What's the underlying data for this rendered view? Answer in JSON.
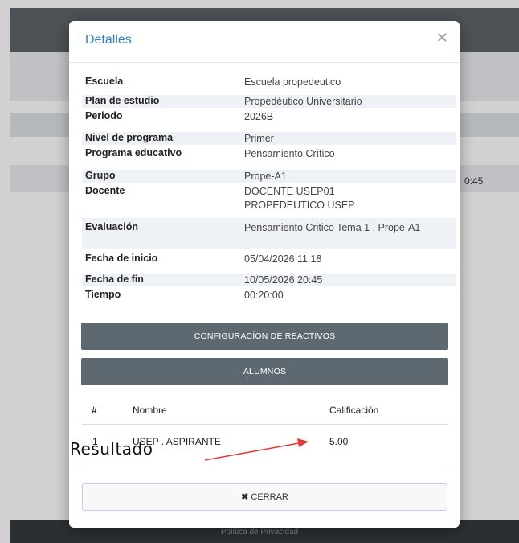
{
  "background": {
    "footer_text": "Política de Privacidad",
    "side_fragment": "0:45"
  },
  "modal": {
    "title": "Detalles",
    "close_icon": "close-icon",
    "details": [
      {
        "label": "Escuela",
        "value": "Escuela propedeutico"
      },
      {
        "label": "Plan de estudio",
        "value": "Propedéutico Universitario"
      },
      {
        "label": "Periodo",
        "value": "2026B"
      },
      {
        "label": "Nivel de programa",
        "value": "Primer"
      },
      {
        "label": "Programa educativo",
        "value": "Pensamiento Crítico"
      },
      {
        "label": "Grupo",
        "value": "Prope-A1"
      },
      {
        "label": "Docente",
        "value": "DOCENTE USEP01 PROPEDEUTICO USEP"
      },
      {
        "label": "Evaluación",
        "value": "Pensamiento Critico Tema 1 , Prope-A1"
      },
      {
        "label": "Fecha de inicio",
        "value": "05/04/2026 11:18"
      },
      {
        "label": "Fecha de fin",
        "value": "10/05/2026 20:45"
      },
      {
        "label": "Tiempo",
        "value": "00:20:00"
      }
    ],
    "config_button": "CONFIGURACÍON DE REACTIVOS",
    "students_button": "ALUMNOS",
    "table": {
      "headers": [
        "#",
        "Nombre",
        "Calificación"
      ],
      "rows": [
        {
          "num": "1",
          "name": "USEP . ASPIRANTE",
          "grade": "5.00"
        }
      ]
    },
    "annotation": "Resultado",
    "annotation_color": "#e53935",
    "close_button": {
      "icon": "✖",
      "label": "CERRAR"
    }
  },
  "colors": {
    "title": "#2b83c6",
    "button_dark": "#5d6870",
    "row_stripe": "#eef2f6"
  }
}
